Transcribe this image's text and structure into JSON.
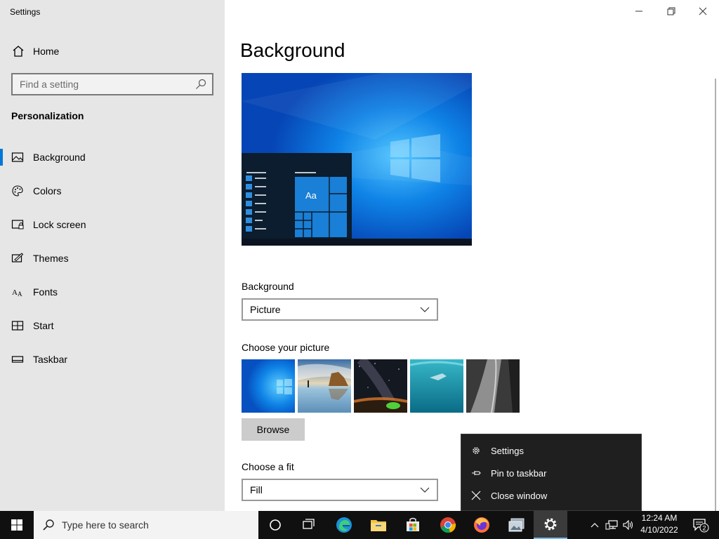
{
  "window": {
    "title": "Settings",
    "controls": [
      "minimize-icon",
      "restore-icon",
      "close-icon"
    ]
  },
  "sidebar": {
    "home_label": "Home",
    "search_placeholder": "Find a setting",
    "section_title": "Personalization",
    "items": [
      {
        "label": "Background",
        "icon": "picture-icon",
        "active": true
      },
      {
        "label": "Colors",
        "icon": "palette-icon",
        "active": false
      },
      {
        "label": "Lock screen",
        "icon": "lock-screen-icon",
        "active": false
      },
      {
        "label": "Themes",
        "icon": "themes-icon",
        "active": false
      },
      {
        "label": "Fonts",
        "icon": "fonts-icon",
        "active": false
      },
      {
        "label": "Start",
        "icon": "start-icon",
        "active": false
      },
      {
        "label": "Taskbar",
        "icon": "taskbar-icon",
        "active": false
      }
    ]
  },
  "main": {
    "title": "Background",
    "preview": {
      "tile_text": "Aa"
    },
    "background_label": "Background",
    "background_value": "Picture",
    "choose_picture_label": "Choose your picture",
    "browse_label": "Browse",
    "fit_label": "Choose a fit",
    "fit_value": "Fill"
  },
  "context_menu": {
    "items": [
      {
        "label": "Settings",
        "icon": "gear-icon"
      },
      {
        "label": "Pin to taskbar",
        "icon": "pin-icon"
      },
      {
        "label": "Close window",
        "icon": "close-icon"
      }
    ]
  },
  "taskbar": {
    "search_placeholder": "Type here to search",
    "apps": [
      "cortana-icon",
      "task-view-icon",
      "edge-icon",
      "file-explorer-icon",
      "store-icon",
      "chrome-icon",
      "firefox-icon",
      "photos-icon",
      "settings-icon"
    ],
    "time": "12:24 AM",
    "date": "4/10/2022",
    "notification_count": "2"
  },
  "colors": {
    "accent": "#0078d7",
    "sidebar_bg": "#e6e6e6",
    "taskbar_bg": "#101010",
    "menu_bg": "#1f1f1f"
  }
}
